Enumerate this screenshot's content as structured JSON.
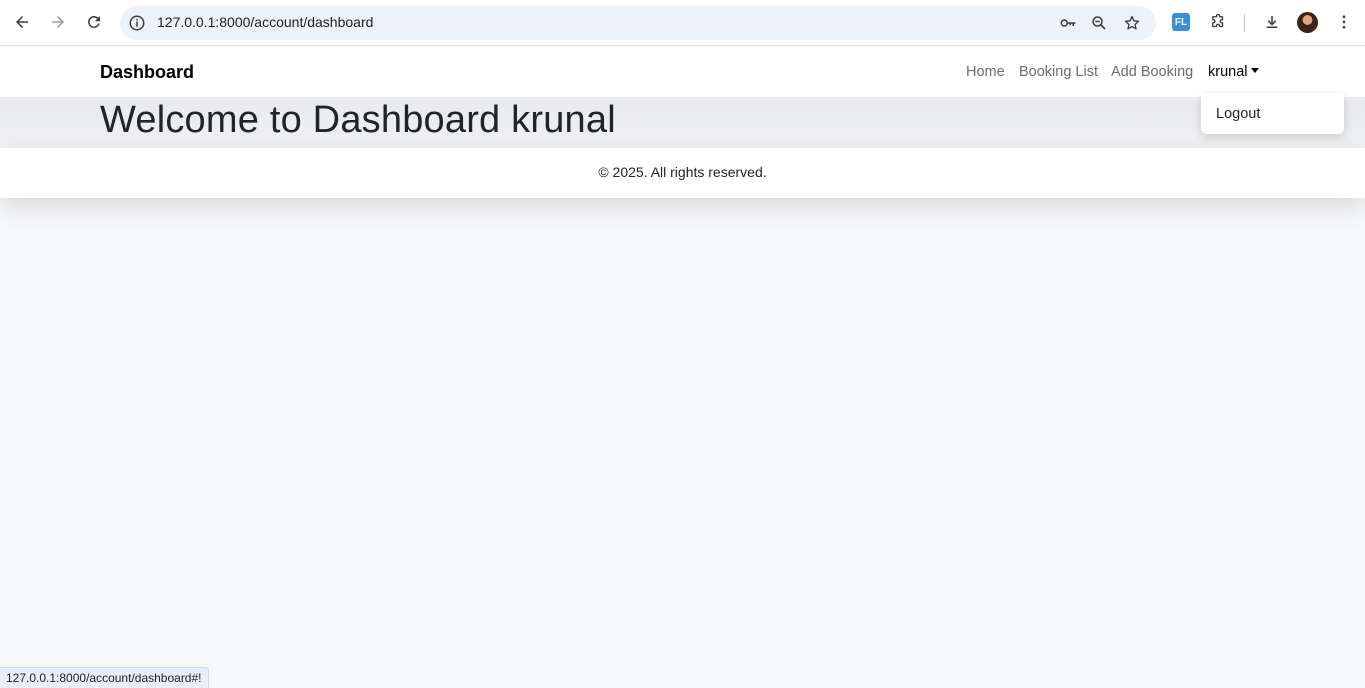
{
  "browser": {
    "url": "127.0.0.1:8000/account/dashboard",
    "extension_label": "FL",
    "status_url": "127.0.0.1:8000/account/dashboard#!"
  },
  "navbar": {
    "brand": "Dashboard",
    "links": [
      "Home",
      "Booking List",
      "Add Booking"
    ],
    "user": "krunal"
  },
  "dropdown": {
    "items": [
      "Logout"
    ]
  },
  "main": {
    "heading": "Welcome to Dashboard krunal"
  },
  "footer": {
    "text": "© 2025. All rights reserved."
  }
}
